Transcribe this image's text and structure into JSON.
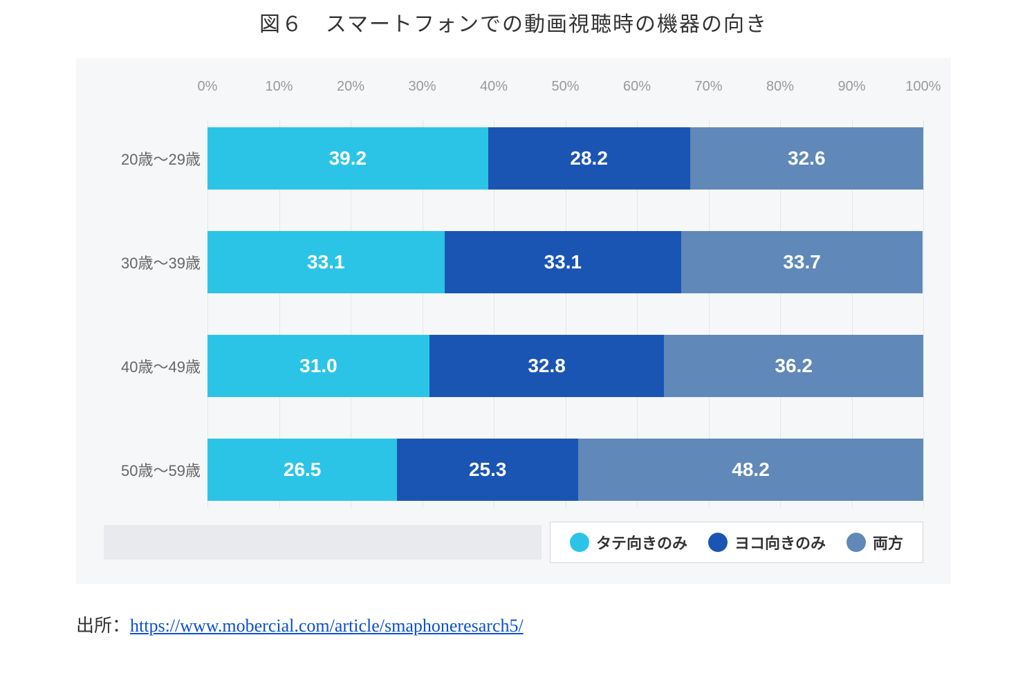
{
  "title": "図６　スマートフォンでの動画視聴時の機器の向き",
  "source_label": "出所：",
  "source_url_text": "https://www.mobercial.com/article/smaphoneresarch5/",
  "legend": {
    "s0": "タテ向きのみ",
    "s1": "ヨコ向きのみ",
    "s2": "両方"
  },
  "ticks": {
    "t0": "0%",
    "t10": "10%",
    "t20": "20%",
    "t30": "30%",
    "t40": "40%",
    "t50": "50%",
    "t60": "60%",
    "t70": "70%",
    "t80": "80%",
    "t90": "90%",
    "t100": "100%"
  },
  "rows": {
    "r0": {
      "label": "20歳～29歳",
      "v0": "39.2",
      "v1": "28.2",
      "v2": "32.6"
    },
    "r1": {
      "label": "30歳～39歳",
      "v0": "33.1",
      "v1": "33.1",
      "v2": "33.7"
    },
    "r2": {
      "label": "40歳～49歳",
      "v0": "31.0",
      "v1": "32.8",
      "v2": "36.2"
    },
    "r3": {
      "label": "50歳～59歳",
      "v0": "26.5",
      "v1": "25.3",
      "v2": "48.2"
    }
  },
  "colors": {
    "series0": "#2cc4e6",
    "series1": "#1b55b3",
    "series2": "#6088b8",
    "background": "#f6f7f8"
  },
  "chart_data": {
    "type": "bar",
    "stacked": true,
    "orientation": "horizontal",
    "title": "図６　スマートフォンでの動画視聴時の機器の向き",
    "xlabel": "",
    "ylabel": "",
    "xlim": [
      0,
      100
    ],
    "x_unit": "%",
    "categories": [
      "20歳～29歳",
      "30歳～39歳",
      "40歳～49歳",
      "50歳～59歳"
    ],
    "series": [
      {
        "name": "タテ向きのみ",
        "values": [
          39.2,
          33.1,
          31.0,
          26.5
        ],
        "color": "#2cc4e6"
      },
      {
        "name": "ヨコ向きのみ",
        "values": [
          28.2,
          33.1,
          32.8,
          25.3
        ],
        "color": "#1b55b3"
      },
      {
        "name": "両方",
        "values": [
          32.6,
          33.7,
          36.2,
          48.2
        ],
        "color": "#6088b8"
      }
    ],
    "grid": true,
    "legend_position": "bottom-right"
  }
}
